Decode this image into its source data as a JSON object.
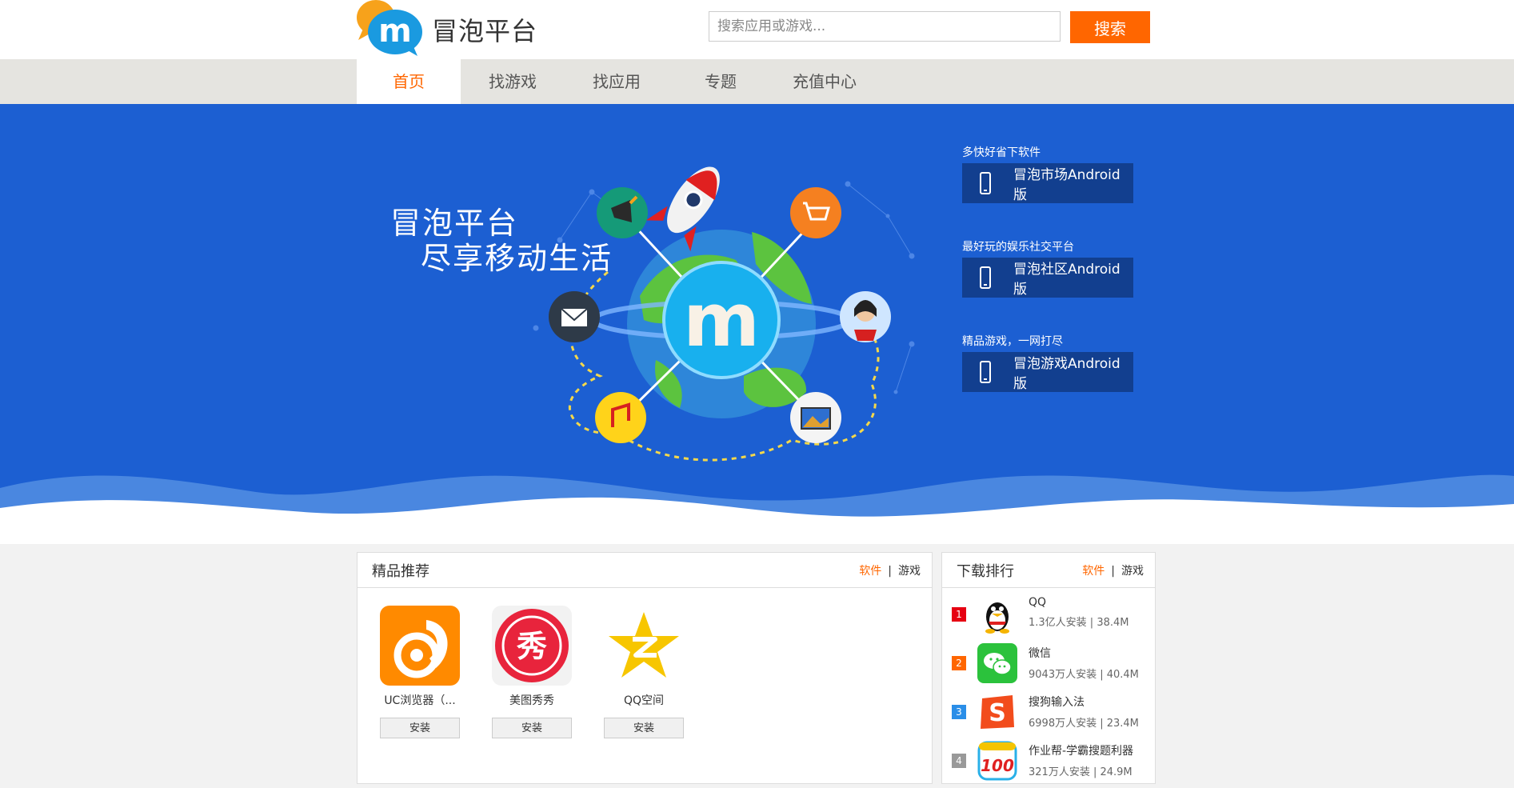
{
  "header": {
    "site_name": "冒泡平台",
    "search_placeholder": "搜索应用或游戏...",
    "search_button": "搜索"
  },
  "nav": {
    "items": [
      "首页",
      "找游戏",
      "找应用",
      "专题",
      "充值中心"
    ],
    "active_index": 0
  },
  "banner": {
    "title_line1": "冒泡平台",
    "title_line2": "尽享移动生活",
    "downloads": [
      {
        "caption": "多快好省下软件",
        "label": "冒泡市场Android版"
      },
      {
        "caption": "最好玩的娱乐社交平台",
        "label": "冒泡社区Android版"
      },
      {
        "caption": "精品游戏，一网打尽",
        "label": "冒泡游戏Android版"
      }
    ]
  },
  "featured": {
    "title": "精品推荐",
    "tabs": [
      "软件",
      "游戏"
    ],
    "apps": [
      {
        "name": "UC浏览器（...",
        "install": "安装",
        "icon": "uc-browser-icon"
      },
      {
        "name": "美图秀秀",
        "install": "安装",
        "icon": "meitu-icon"
      },
      {
        "name": "QQ空间",
        "install": "安装",
        "icon": "qzone-icon"
      }
    ]
  },
  "ranking": {
    "title": "下载排行",
    "tabs": [
      "软件",
      "游戏"
    ],
    "items": [
      {
        "rank": "1",
        "name": "QQ",
        "meta": "1.3亿人安装 | 38.4M",
        "icon": "qq-icon",
        "rank_color": "#e60012"
      },
      {
        "rank": "2",
        "name": "微信",
        "meta": "9043万人安装 | 40.4M",
        "icon": "wechat-icon",
        "rank_color": "#ff6600"
      },
      {
        "rank": "3",
        "name": "搜狗输入法",
        "meta": "6998万人安装 | 23.4M",
        "icon": "sogou-icon",
        "rank_color": "#2a8ee8"
      },
      {
        "rank": "4",
        "name": "作业帮-学霸搜题利器",
        "meta": "321万人安装 | 24.9M",
        "icon": "zuoyebang-icon",
        "rank_color": "#999999"
      }
    ]
  },
  "colors": {
    "accent": "#ff6600",
    "banner_bg": "#1c5fd2",
    "download_button_bg": "#123f8f"
  }
}
